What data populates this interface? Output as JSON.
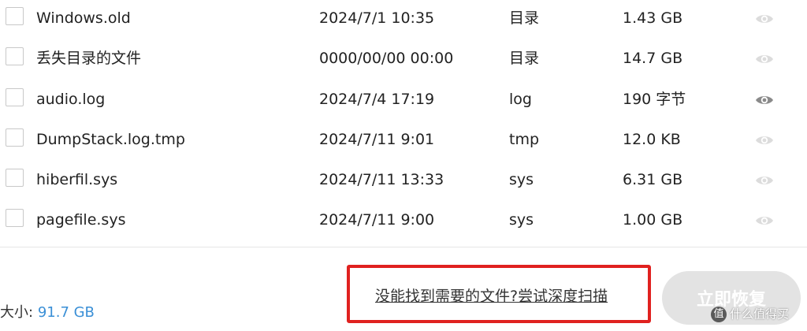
{
  "files": [
    {
      "name": "Windows.old",
      "date": "2024/7/1 10:35",
      "type": "目录",
      "size": "1.43 GB",
      "preview_enabled": false
    },
    {
      "name": "丢失目录的文件",
      "date": "0000/00/00 00:00",
      "type": "目录",
      "size": "14.7 GB",
      "preview_enabled": false
    },
    {
      "name": "audio.log",
      "date": "2024/7/4 17:19",
      "type": "log",
      "size": "190 字节",
      "preview_enabled": true
    },
    {
      "name": "DumpStack.log.tmp",
      "date": "2024/7/11 9:01",
      "type": "tmp",
      "size": "12.0 KB",
      "preview_enabled": false
    },
    {
      "name": "hiberfil.sys",
      "date": "2024/7/11 13:33",
      "type": "sys",
      "size": "6.31 GB",
      "preview_enabled": false
    },
    {
      "name": "pagefile.sys",
      "date": "2024/7/11 9:00",
      "type": "sys",
      "size": "1.00 GB",
      "preview_enabled": false
    }
  ],
  "footer": {
    "total_label": "大小:",
    "total_value": "91.7 GB",
    "deep_scan_link": "没能找到需要的文件?尝试深度扫描",
    "recover_button": "立即恢复"
  },
  "watermark": {
    "logo_char": "值",
    "text": "什么值得买"
  },
  "icons": {
    "eye": "eye-icon",
    "checkbox": "checkbox"
  },
  "colors": {
    "eye_active": "#8a8a8a",
    "eye_inactive": "#dcdcdc",
    "highlight": "#e0211f",
    "size_value": "#3a8fd6",
    "button_disabled": "#e3e3e3"
  }
}
